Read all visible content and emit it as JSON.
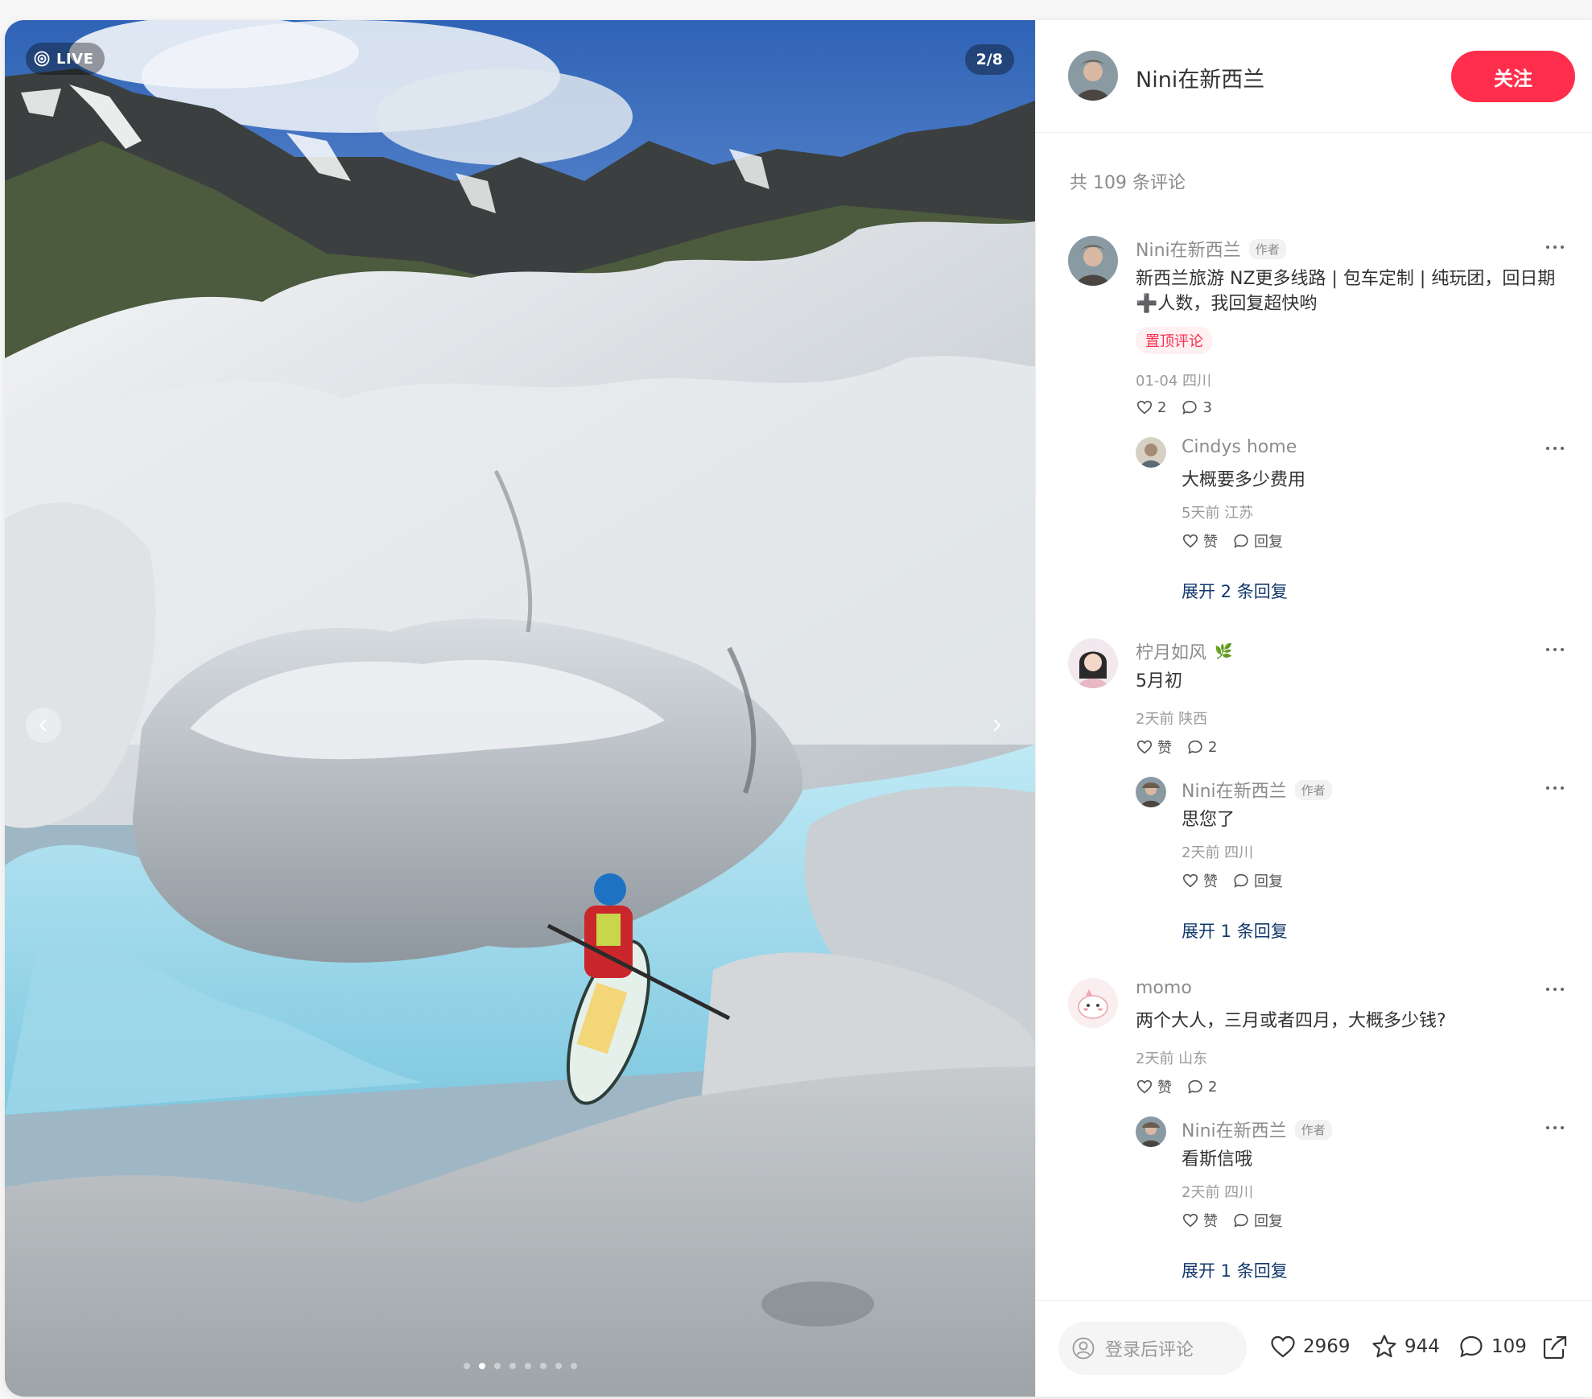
{
  "media": {
    "live_label": "LIVE",
    "page_counter": "2/8",
    "total_slides": 8,
    "active_slide": 2
  },
  "author": {
    "name": "Nini在新西兰",
    "follow_label": "关注"
  },
  "comments_total": "共 109 条评论",
  "comments": [
    {
      "name": "Nini在新西兰",
      "author_tag": "作者",
      "text": "新西兰旅游 NZ更多线路 | 包车定制 | 纯玩团，回日期",
      "text_line2": "➕人数，我回复超快哟",
      "pinned_label": "置顶评论",
      "meta": "01-04 四川",
      "likes": "2",
      "replies": "3",
      "reply": {
        "name": "Cindys home",
        "text": "大概要多少费用",
        "meta": "5天前 江苏",
        "like_label": "赞",
        "reply_label": "回复"
      },
      "expand_label": "展开 2 条回复"
    },
    {
      "name": "柠月如风",
      "name_emoji": "🌿",
      "text": "5月初",
      "meta": "2天前 陕西",
      "like_label": "赞",
      "replies": "2",
      "reply": {
        "name": "Nini在新西兰",
        "author_tag": "作者",
        "text": "思您了",
        "meta": "2天前 四川",
        "like_label": "赞",
        "reply_label": "回复"
      },
      "expand_label": "展开 1 条回复"
    },
    {
      "name": "momo",
      "text": "两个大人，三月或者四月，大概多少钱?",
      "meta": "2天前 山东",
      "like_label": "赞",
      "replies": "2",
      "reply": {
        "name": "Nini在新西兰",
        "author_tag": "作者",
        "text": "看斯信哦",
        "meta": "2天前 四川",
        "like_label": "赞",
        "reply_label": "回复"
      },
      "expand_label": "展开 1 条回复"
    }
  ],
  "bottom_bar": {
    "input_placeholder": "登录后评论",
    "likes": "2969",
    "collects": "944",
    "comments": "109"
  },
  "colors": {
    "accent": "#ff2e4d",
    "link": "#13386c"
  }
}
